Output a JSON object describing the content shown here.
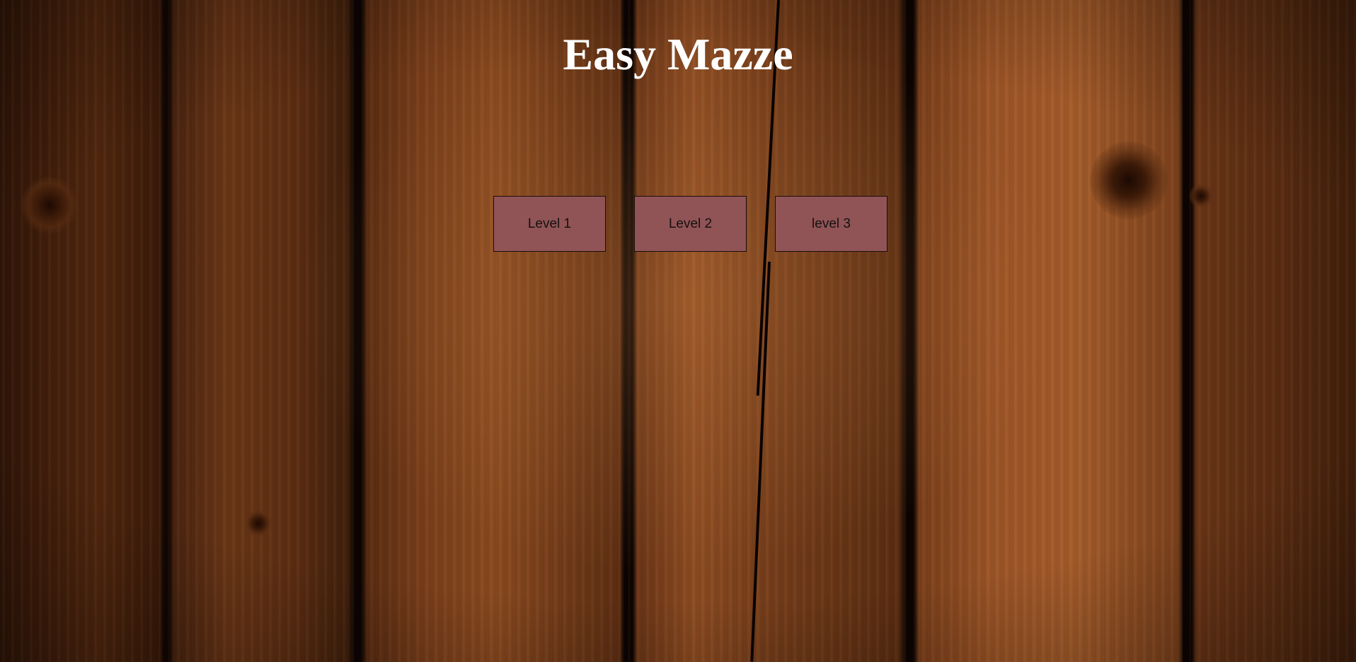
{
  "title": "Easy Mazze",
  "levels": [
    {
      "label": "Level 1"
    },
    {
      "label": "Level 2"
    },
    {
      "label": "level 3"
    }
  ],
  "colors": {
    "button_background": "#905456",
    "button_border": "#1a0d0d",
    "title_text": "#ffffff",
    "background": "wooden-planks"
  }
}
